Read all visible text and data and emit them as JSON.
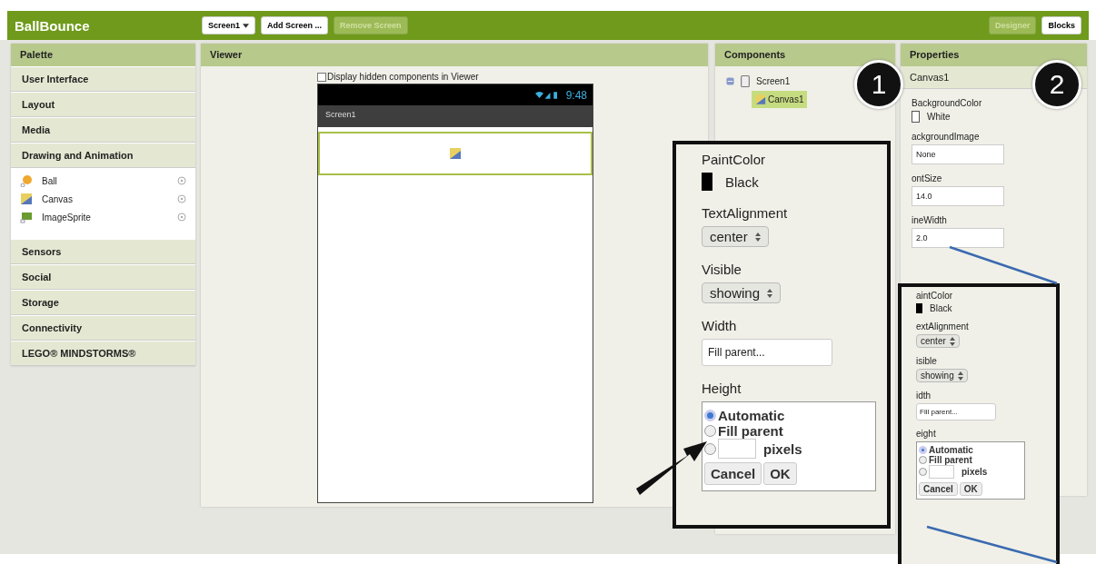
{
  "app_bar": {
    "title": "BallBounce",
    "buttons": [
      {
        "label": "Screen1",
        "kind": "dropdown",
        "disabled": false
      },
      {
        "label": "Add Screen ...",
        "kind": "button",
        "disabled": false
      },
      {
        "label": "Remove Screen",
        "kind": "button",
        "disabled": true
      }
    ],
    "view_tabs": [
      {
        "label": "Designer",
        "selected": true
      },
      {
        "label": "Blocks",
        "selected": false
      }
    ]
  },
  "palette": {
    "title": "Palette",
    "categories": [
      {
        "label": "User Interface"
      },
      {
        "label": "Layout"
      },
      {
        "label": "Media"
      },
      {
        "label": "Drawing and Animation",
        "items": [
          {
            "label": "Ball",
            "kind": "ball"
          },
          {
            "label": "Canvas",
            "kind": "canvas"
          },
          {
            "label": "ImageSprite",
            "kind": "sprite"
          }
        ]
      },
      {
        "label": "Sensors"
      },
      {
        "label": "Social"
      },
      {
        "label": "Storage"
      },
      {
        "label": "Connectivity"
      },
      {
        "label": "LEGO® MINDSTORMS®"
      }
    ]
  },
  "viewer": {
    "title": "Viewer",
    "hidden_checkbox": {
      "label": "Display hidden components in Viewer",
      "checked": false
    },
    "phone": {
      "time": "9:48",
      "screen_title": "Screen1"
    }
  },
  "components": {
    "title": "Components",
    "tree": [
      {
        "label": "Screen1",
        "expanded": true,
        "selected": false,
        "children": [
          {
            "label": "Canvas1",
            "selected": true
          }
        ]
      }
    ]
  },
  "properties": {
    "title": "Properties",
    "component": "Canvas1",
    "items": [
      {
        "kind": "color",
        "label": "BackgroundColor",
        "value": "White",
        "color": "#ffffff"
      },
      {
        "kind": "text",
        "label": "ackgroundImage",
        "value": "None"
      },
      {
        "kind": "text",
        "label": "ontSize",
        "value": "14.0"
      },
      {
        "kind": "text",
        "label": "ineWidth",
        "value": "2.0"
      }
    ]
  },
  "markers": [
    {
      "number": "1"
    },
    {
      "number": "2"
    }
  ],
  "zoom_panels": [
    {
      "fields": [
        {
          "kind": "color",
          "label": "PaintColor",
          "value": "Black",
          "color": "#000000"
        },
        {
          "kind": "select",
          "label": "TextAlignment",
          "value": "center"
        },
        {
          "kind": "select",
          "label": "Visible",
          "value": "showing"
        },
        {
          "kind": "text",
          "label": "Width",
          "value": "Fill parent..."
        },
        {
          "kind": "height",
          "label": "Height",
          "options": [
            {
              "label": "Automatic",
              "selected": true
            },
            {
              "label": "Fill parent",
              "selected": false
            },
            {
              "label": "pixels",
              "selected": false
            }
          ],
          "buttons": [
            "Cancel",
            "OK"
          ]
        }
      ]
    },
    {
      "fields": [
        {
          "kind": "color",
          "label": "aintColor",
          "value": "Black",
          "color": "#000000"
        },
        {
          "kind": "select",
          "label": "extAlignment",
          "value": "center"
        },
        {
          "kind": "select",
          "label": "isible",
          "value": "showing"
        },
        {
          "kind": "text",
          "label": "idth",
          "value": "Fill parent..."
        },
        {
          "kind": "height",
          "label": "eight",
          "options": [
            {
              "label": "Automatic",
              "selected": true
            },
            {
              "label": "Fill parent",
              "selected": false
            },
            {
              "label": "pixels",
              "selected": false
            }
          ],
          "buttons": [
            "Cancel",
            "OK"
          ]
        }
      ]
    }
  ]
}
